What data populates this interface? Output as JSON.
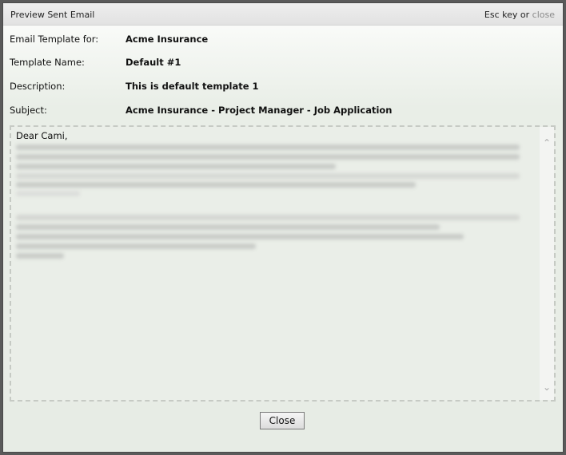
{
  "dialog": {
    "title": "Preview Sent Email",
    "hint_prefix": "Esc key or ",
    "hint_close": "close"
  },
  "fields": {
    "template_for": {
      "label": "Email Template for:",
      "value": "Acme Insurance"
    },
    "template_name": {
      "label": "Template Name:",
      "value": "Default #1"
    },
    "description": {
      "label": "Description:",
      "value": "This is default template 1"
    },
    "subject": {
      "label": "Subject:",
      "value": "Acme Insurance - Project Manager - Job Application"
    }
  },
  "email": {
    "salutation": "Dear Cami,"
  },
  "buttons": {
    "close": "Close"
  }
}
